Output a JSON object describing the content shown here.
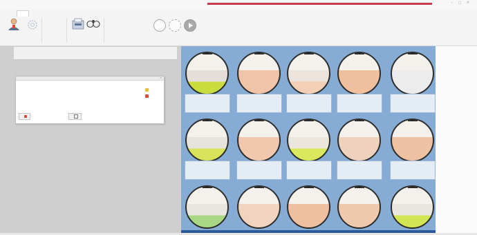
{
  "window": {
    "title": "",
    "controls": "– ▢ ✕"
  },
  "ribbon": {
    "tabs": [
      "",
      "",
      ""
    ],
    "items": [
      {
        "label": ""
      },
      {
        "label": ""
      },
      {
        "label": ""
      },
      {
        "label": ""
      },
      {
        "label": ""
      }
    ],
    "groups": [
      "",
      ""
    ]
  },
  "grid_header": {
    "columns": [
      "",
      "",
      "",
      "",
      "",
      "",
      "",
      "",
      "",
      "",
      ""
    ]
  },
  "dialog": {
    "title": "",
    "message1": "",
    "message2": "",
    "button_left": "",
    "button_right": ""
  },
  "tables": [
    {
      "top": "",
      "line1": "",
      "line2": "",
      "line3": "",
      "fill": "#e3dfd8",
      "accent": "#c9dd3f",
      "card1": "",
      "card2": "",
      "card3": ""
    },
    {
      "top": "",
      "line1": "",
      "line2": "",
      "line3": "",
      "fill": "#f0c4a8",
      "accent": "#f0c4a8",
      "card1": "",
      "card2": "",
      "card3": ""
    },
    {
      "top": "",
      "line1": "",
      "line2": "",
      "line3": "",
      "fill": "#ece4dc",
      "accent": "#f2cfb6",
      "card1": "",
      "card2": "",
      "card3": ""
    },
    {
      "top": "",
      "line1": "",
      "line2": "",
      "line3": "",
      "fill": "#efbf9e",
      "accent": "#efbf9e",
      "card1": "",
      "card2": "",
      "card3": ""
    },
    {
      "top": "",
      "line1": "",
      "line2": "",
      "line3": "",
      "fill": "#ececec",
      "accent": "#ececec",
      "card1": "",
      "card2": "",
      "card3": ""
    },
    {
      "top": "",
      "line1": "",
      "line2": "",
      "line3": "",
      "fill": "#e6e3dc",
      "accent": "#d7e35a",
      "card1": "",
      "card2": "",
      "card3": ""
    },
    {
      "top": "",
      "line1": "",
      "line2": "",
      "line3": "",
      "fill": "#f1c8ad",
      "accent": "#f1c8ad",
      "card1": "",
      "card2": "",
      "card3": ""
    },
    {
      "top": "",
      "line1": "",
      "line2": "",
      "line3": "",
      "fill": "#ebe7dc",
      "accent": "#d9e85c",
      "card1": "",
      "card2": "",
      "card3": ""
    },
    {
      "top": "",
      "line1": "",
      "line2": "",
      "line3": "",
      "fill": "#efd2bd",
      "accent": "#efd2bd",
      "card1": "",
      "card2": "",
      "card3": ""
    },
    {
      "top": "",
      "line1": "",
      "line2": "",
      "line3": "",
      "fill": "#efc2a3",
      "accent": "#efc2a3",
      "card1": "",
      "card2": "",
      "card3": ""
    },
    {
      "top": "",
      "line1": "",
      "line2": "",
      "line3": "",
      "fill": "#e8e6e0",
      "accent": "#a8d884",
      "card1": "",
      "card2": "",
      "card3": ""
    },
    {
      "top": "",
      "line1": "",
      "line2": "",
      "line3": "",
      "fill": "#f1d4bf",
      "accent": "#f1d4bf",
      "card1": "",
      "card2": "",
      "card3": ""
    },
    {
      "top": "",
      "line1": "",
      "line2": "",
      "line3": "",
      "fill": "#efc0a0",
      "accent": "#efc0a0",
      "card1": "",
      "card2": "",
      "card3": ""
    },
    {
      "top": "",
      "line1": "",
      "line2": "",
      "line3": "",
      "fill": "#efc9ae",
      "accent": "#efc9ae",
      "card1": "",
      "card2": "",
      "card3": ""
    },
    {
      "top": "",
      "line1": "",
      "line2": "",
      "line3": "",
      "fill": "#e8e6e0",
      "accent": "#d2e552",
      "card1": "",
      "card2": "",
      "card3": ""
    }
  ],
  "colors": {
    "table_area": "#86abd4",
    "status_strip": "#2c5a98",
    "title_accent": "#c9384c"
  }
}
